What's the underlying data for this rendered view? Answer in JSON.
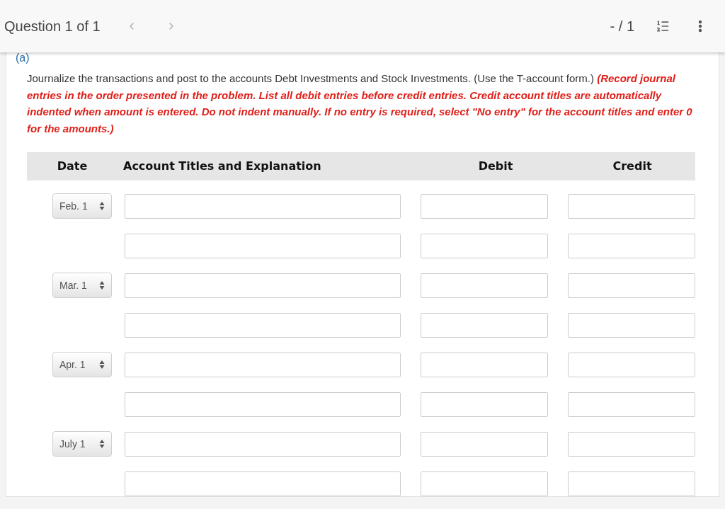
{
  "header": {
    "title": "Question 1 of 1",
    "score": "- / 1"
  },
  "part": "(a)",
  "instruction": {
    "text": "Journalize the transactions and post to the accounts Debt Investments and Stock Investments. (Use the T-account form.)",
    "note": "(Record journal entries in the order presented in the problem. List all debit entries before credit entries. Credit account titles are automatically indented when amount is entered. Do not indent manually. If no entry is required, select \"No entry\" for the account titles and enter 0 for the amounts.)"
  },
  "table": {
    "columns": [
      "Date",
      "Account Titles and Explanation",
      "Debit",
      "Credit"
    ],
    "entries": [
      {
        "date": "Feb. 1"
      },
      {
        "date": "Mar. 1"
      },
      {
        "date": "Apr. 1"
      },
      {
        "date": "July 1"
      }
    ]
  }
}
